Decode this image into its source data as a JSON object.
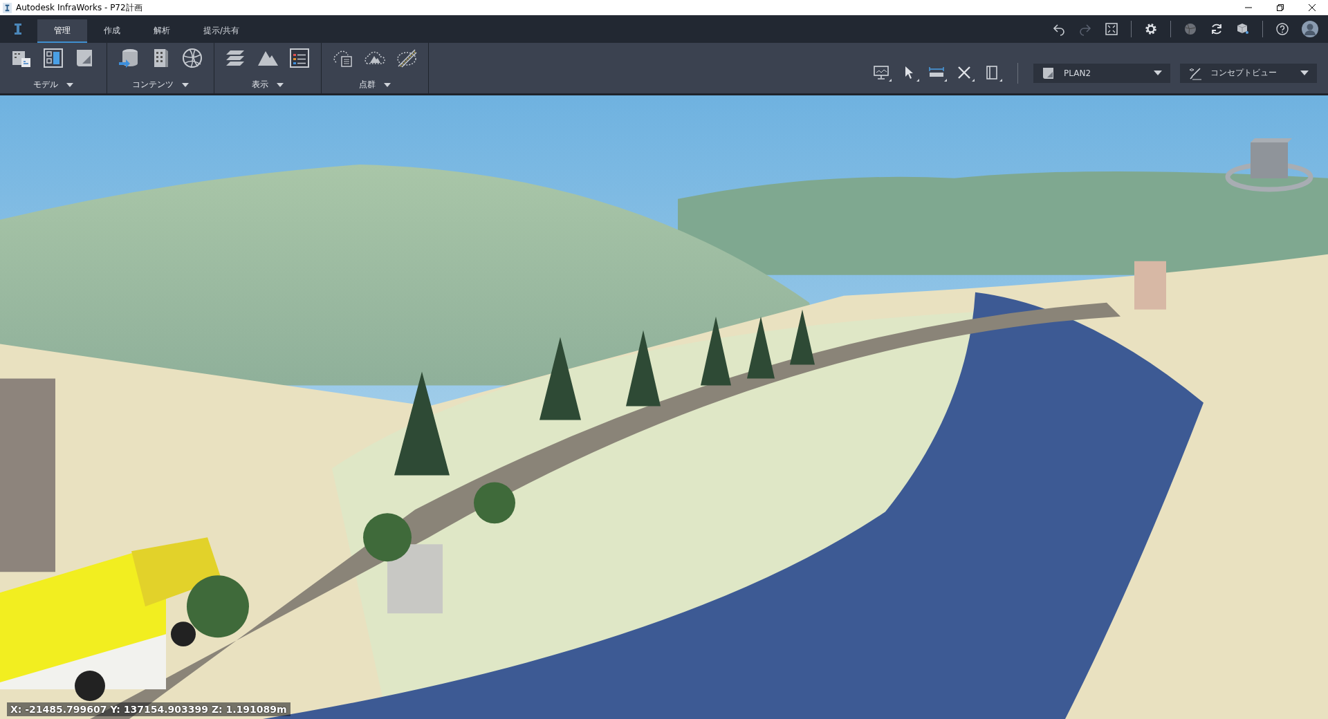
{
  "window": {
    "title": "Autodesk InfraWorks - P72計画"
  },
  "tabs": [
    {
      "label": "管理",
      "selected": true
    },
    {
      "label": "作成",
      "selected": false
    },
    {
      "label": "解析",
      "selected": false
    },
    {
      "label": "提示/共有",
      "selected": false
    }
  ],
  "history_buttons": [
    {
      "kind": "undo",
      "disabled": false
    },
    {
      "kind": "redo",
      "disabled": true
    }
  ],
  "ribbon_groups": [
    {
      "label": "モデル"
    },
    {
      "label": "コンテンツ"
    },
    {
      "label": "表示"
    },
    {
      "label": "点群"
    }
  ],
  "proposal_dropdown": {
    "value": "PLAN2"
  },
  "view_dropdown": {
    "value": "コンセプトビュー"
  },
  "coordinates": "X: -21485.799607 Y: 137154.903399 Z: 1.191089m"
}
